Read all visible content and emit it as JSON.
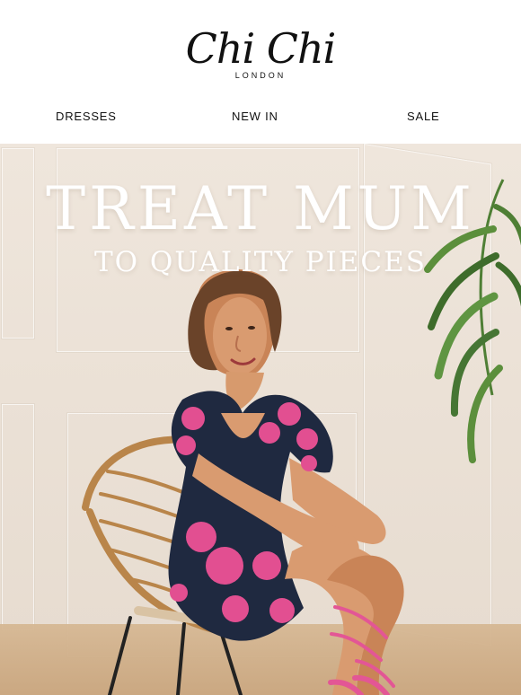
{
  "header": {
    "brand": {
      "name": "Chi Chi",
      "location": "LONDON"
    },
    "nav": [
      {
        "label": "DRESSES"
      },
      {
        "label": "NEW IN"
      },
      {
        "label": "SALE"
      }
    ]
  },
  "hero": {
    "headline": "TREAT MUM",
    "subheadline": "TO QUALITY PIECES",
    "colors": {
      "text": "#ffffff",
      "wall": "#efe6dc",
      "dress": "#1f2940",
      "accent": "#e24f91",
      "chair": "#b9854a",
      "plant": "#4f7f35"
    }
  }
}
